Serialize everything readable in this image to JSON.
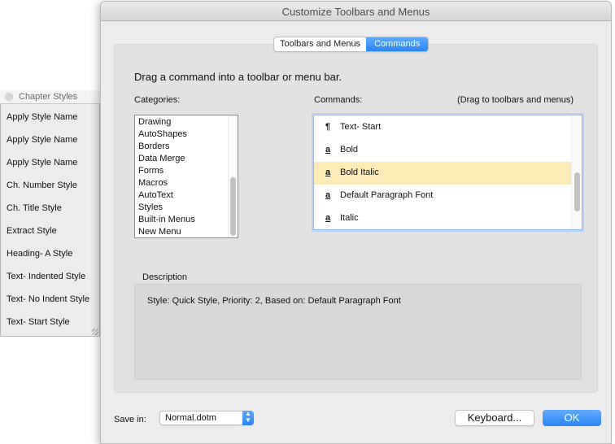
{
  "palette": {
    "title": "Chapter Styles",
    "items": [
      "Apply Style Name",
      "Apply Style Name",
      "Apply Style Name",
      "Ch. Number Style",
      "Ch. Title Style",
      "Extract Style",
      "Heading- A Style",
      "Text- Indented Style",
      "Text- No Indent Style",
      "Text- Start Style"
    ]
  },
  "dialog": {
    "title": "Customize Toolbars and Menus",
    "tabs": [
      {
        "label": "Toolbars and Menus",
        "active": false
      },
      {
        "label": "Commands",
        "active": true
      }
    ],
    "instruction": "Drag a command into a toolbar or menu bar.",
    "categories_label": "Categories:",
    "categories": [
      "Drawing",
      "AutoShapes",
      "Borders",
      "Data Merge",
      "Forms",
      "Macros",
      "AutoText",
      "Styles",
      "Built-in Menus",
      "New Menu"
    ],
    "commands_label": "Commands:",
    "commands_hint": "(Drag to toolbars and menus)",
    "commands": [
      {
        "icon": "¶",
        "icon_name": "paragraph-style-icon",
        "label": "Text- Start",
        "selected": false
      },
      {
        "icon": "a",
        "icon_name": "character-style-icon",
        "label": "Bold",
        "selected": false
      },
      {
        "icon": "a",
        "icon_name": "character-style-icon",
        "label": "Bold Italic",
        "selected": true
      },
      {
        "icon": "a",
        "icon_name": "character-style-icon",
        "label": "Default Paragraph Font",
        "selected": false
      },
      {
        "icon": "a",
        "icon_name": "character-style-icon",
        "label": "Italic",
        "selected": false
      }
    ],
    "description_label": "Description",
    "description_text": "Style: Quick Style, Priority: 2, Based on: Default Paragraph Font",
    "save_in_label": "Save in:",
    "save_in_value": "Normal.dotm",
    "keyboard_button": "Keyboard...",
    "ok_button": "OK",
    "colors": {
      "accent": "#2a85f5",
      "selection": "#fcebb6"
    }
  }
}
